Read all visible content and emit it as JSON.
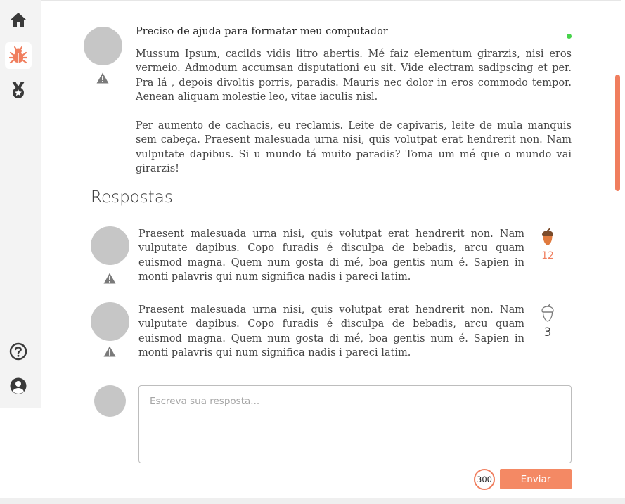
{
  "sidebar": {
    "items": [
      {
        "icon": "home-icon"
      },
      {
        "icon": "bug-icon",
        "active": true
      },
      {
        "icon": "medal-icon"
      },
      {
        "icon": "help-icon"
      },
      {
        "icon": "user-icon"
      }
    ]
  },
  "question": {
    "title": "Preciso de ajuda para formatar meu computador",
    "online": true,
    "paragraphs": [
      "Mussum Ipsum, cacilds vidis litro abertis. Mé faiz elementum girarzis, nisi eros vermeio. Admodum accumsan disputationi eu sit. Vide electram sadipscing et per. Pra lá , depois divoltis porris, paradis. Mauris nec dolor in eros commodo tempor. Aenean aliquam molestie leo, vitae iaculis nisl.",
      "Per aumento de cachacis, eu reclamis. Leite de capivaris, leite de mula manquis sem cabeça. Praesent malesuada urna nisi, quis volutpat erat hendrerit non. Nam vulputate dapibus. Si u mundo tá muito paradis? Toma um mé que o mundo vai girarzis!"
    ]
  },
  "answers": {
    "heading": "Respostas",
    "items": [
      {
        "text": "Praesent malesuada urna nisi, quis volutpat erat hendrerit non. Nam vulputate dapibus. Copo furadis é disculpa de bebadis, arcu quam euismod magna. Quem num gosta di mé, boa gentis num é. Sapien in monti palavris qui num significa nadis i pareci latim.",
        "votes": "12",
        "voted": true
      },
      {
        "text": "Praesent malesuada urna nisi, quis volutpat erat hendrerit non. Nam vulputate dapibus. Copo furadis é disculpa de bebadis, arcu quam euismod magna. Quem num gosta di mé, boa gentis num é. Sapien in monti palavris qui num significa nadis i pareci latim.",
        "votes": "3",
        "voted": false
      }
    ]
  },
  "reply": {
    "placeholder": "Escreva sua resposta...",
    "value": "",
    "char_counter": "300",
    "send_label": "Enviar"
  },
  "colors": {
    "accent": "#f48964",
    "online": "#47d34b",
    "avatar": "#c6c6c6",
    "sidebar_bg": "#f3f3f3"
  }
}
